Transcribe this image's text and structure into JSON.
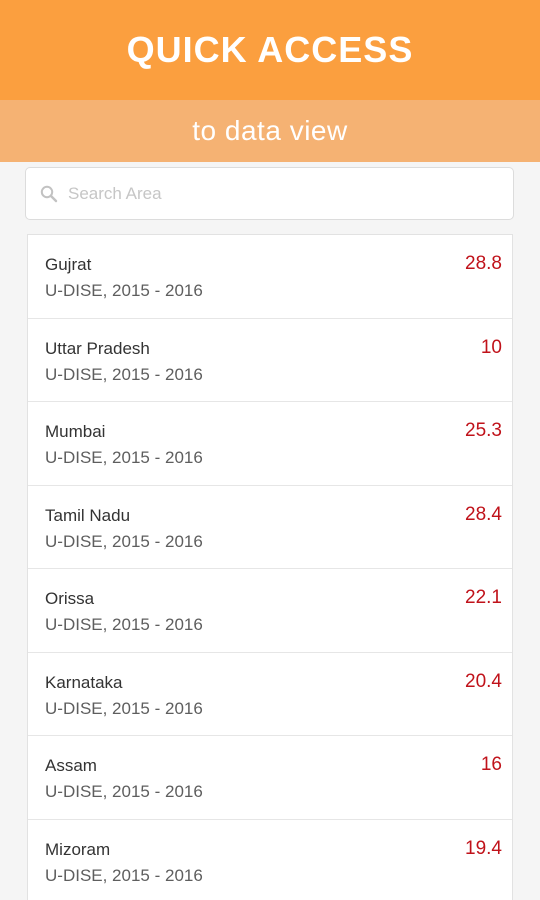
{
  "header": {
    "title": "QUICK ACCESS",
    "subtitle": "to data view"
  },
  "search": {
    "placeholder": "Search Area",
    "value": ""
  },
  "colors": {
    "header_bg": "#fb9f3f",
    "subheader_bg": "#f5b273",
    "value_color": "#c0121a"
  },
  "icons": {
    "search": "magnifier-icon"
  },
  "list": {
    "items": [
      {
        "name": "Gujrat",
        "source": "U-DISE, 2015 - 2016",
        "value": "28.8"
      },
      {
        "name": "Uttar Pradesh",
        "source": "U-DISE, 2015 - 2016",
        "value": "10"
      },
      {
        "name": "Mumbai",
        "source": "U-DISE, 2015 - 2016",
        "value": "25.3"
      },
      {
        "name": "Tamil Nadu",
        "source": "U-DISE, 2015 - 2016",
        "value": "28.4"
      },
      {
        "name": "Orissa",
        "source": "U-DISE, 2015 - 2016",
        "value": "22.1"
      },
      {
        "name": "Karnataka",
        "source": "U-DISE, 2015 - 2016",
        "value": "20.4"
      },
      {
        "name": "Assam",
        "source": "U-DISE, 2015 - 2016",
        "value": "16"
      },
      {
        "name": "Mizoram",
        "source": "U-DISE, 2015 - 2016",
        "value": "19.4"
      }
    ]
  }
}
